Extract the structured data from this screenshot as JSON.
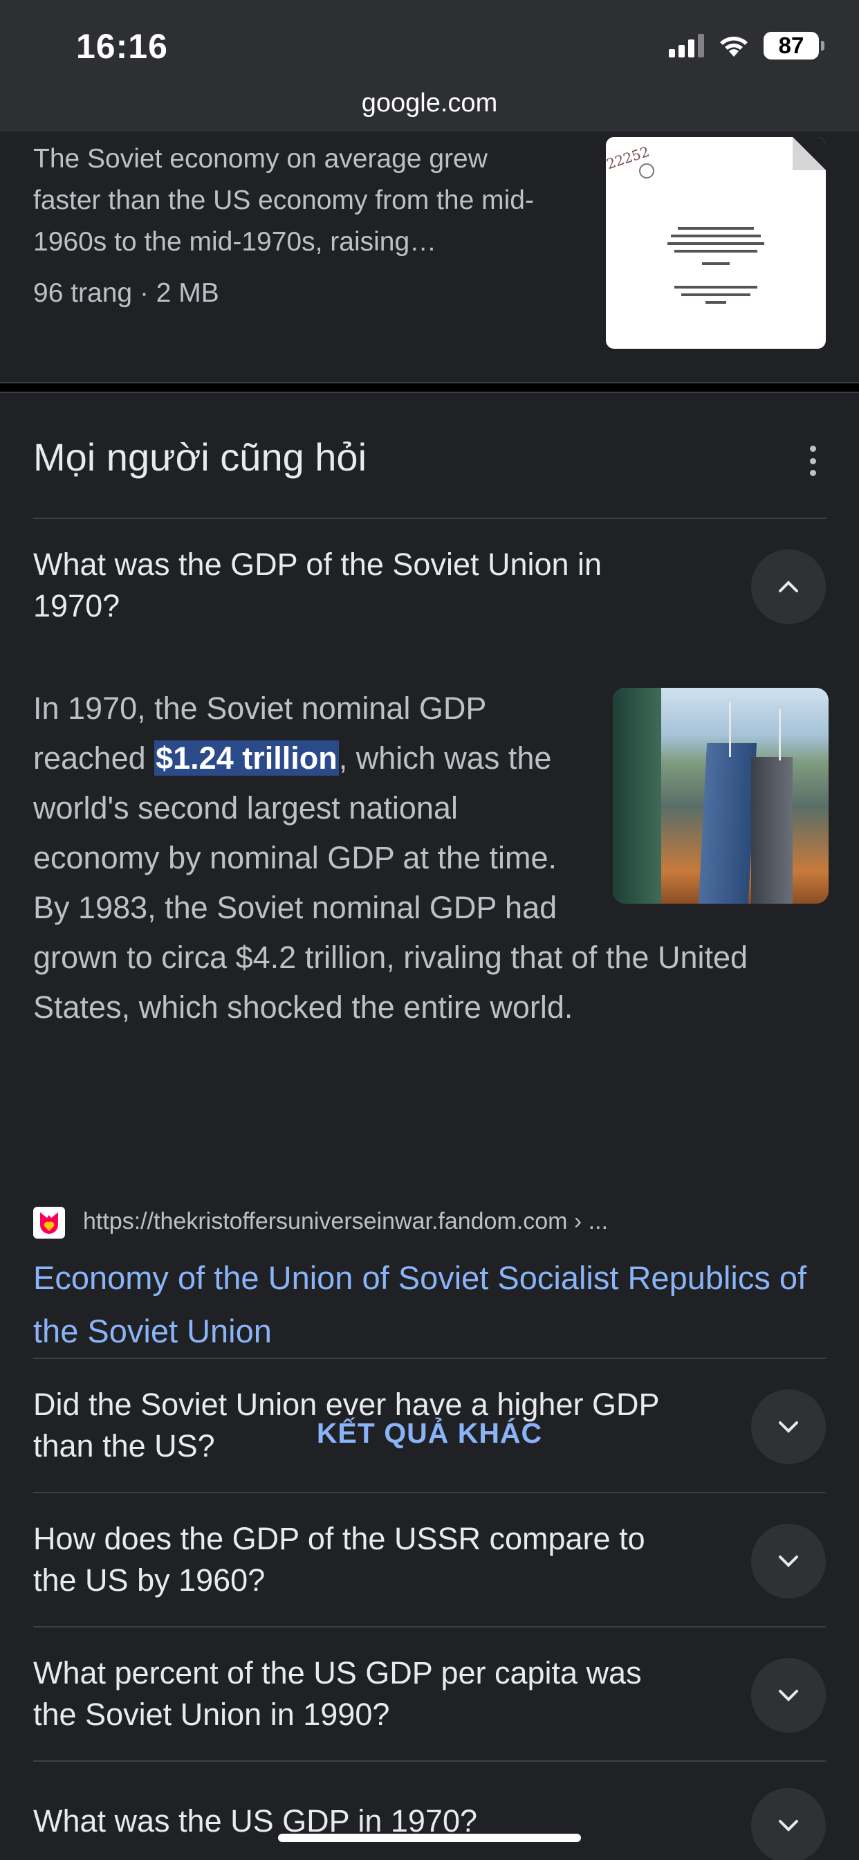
{
  "status_bar": {
    "time": "16:16",
    "battery": "87"
  },
  "browser": {
    "url": "google.com"
  },
  "pdf_result": {
    "snippet": "The Soviet economy on average grew faster than the US economy from the mid-1960s to the mid-1970s, raising…",
    "meta": "96 trang · 2 MB",
    "thumbnail_icon": "document-thumbnail"
  },
  "people_also_ask": {
    "title": "Mọi người cũng hỏi",
    "expanded": {
      "question": "What was the GDP of the Soviet Union in 1970?",
      "answer_before": "In 1970, the Soviet nominal GDP reached ",
      "answer_highlight": "$1.24 trillion",
      "answer_after": ", which was the world's second largest national economy by nominal GDP at the time. By 1983, the Soviet nominal GDP had grown to circa $4.2 trillion, rivaling that of the United States, which shocked the entire world.",
      "source_url": "https://thekristoffersuniverseinwar.fandom.com › ...",
      "source_title": "Economy of the Union of Soviet Socialist Republics of the Soviet Union"
    },
    "more_results_label": "KẾT QUẢ KHÁC",
    "questions": [
      "Did the Soviet Union ever have a higher GDP than the US?",
      "How does the GDP of the USSR compare to the US by 1960?",
      "What percent of the US GDP per capita was the Soviet Union in 1990?",
      "What was the US GDP in 1970?"
    ]
  },
  "colors": {
    "link": "#8ab4f8",
    "highlight": "#2a4a8a",
    "background": "#202124"
  }
}
